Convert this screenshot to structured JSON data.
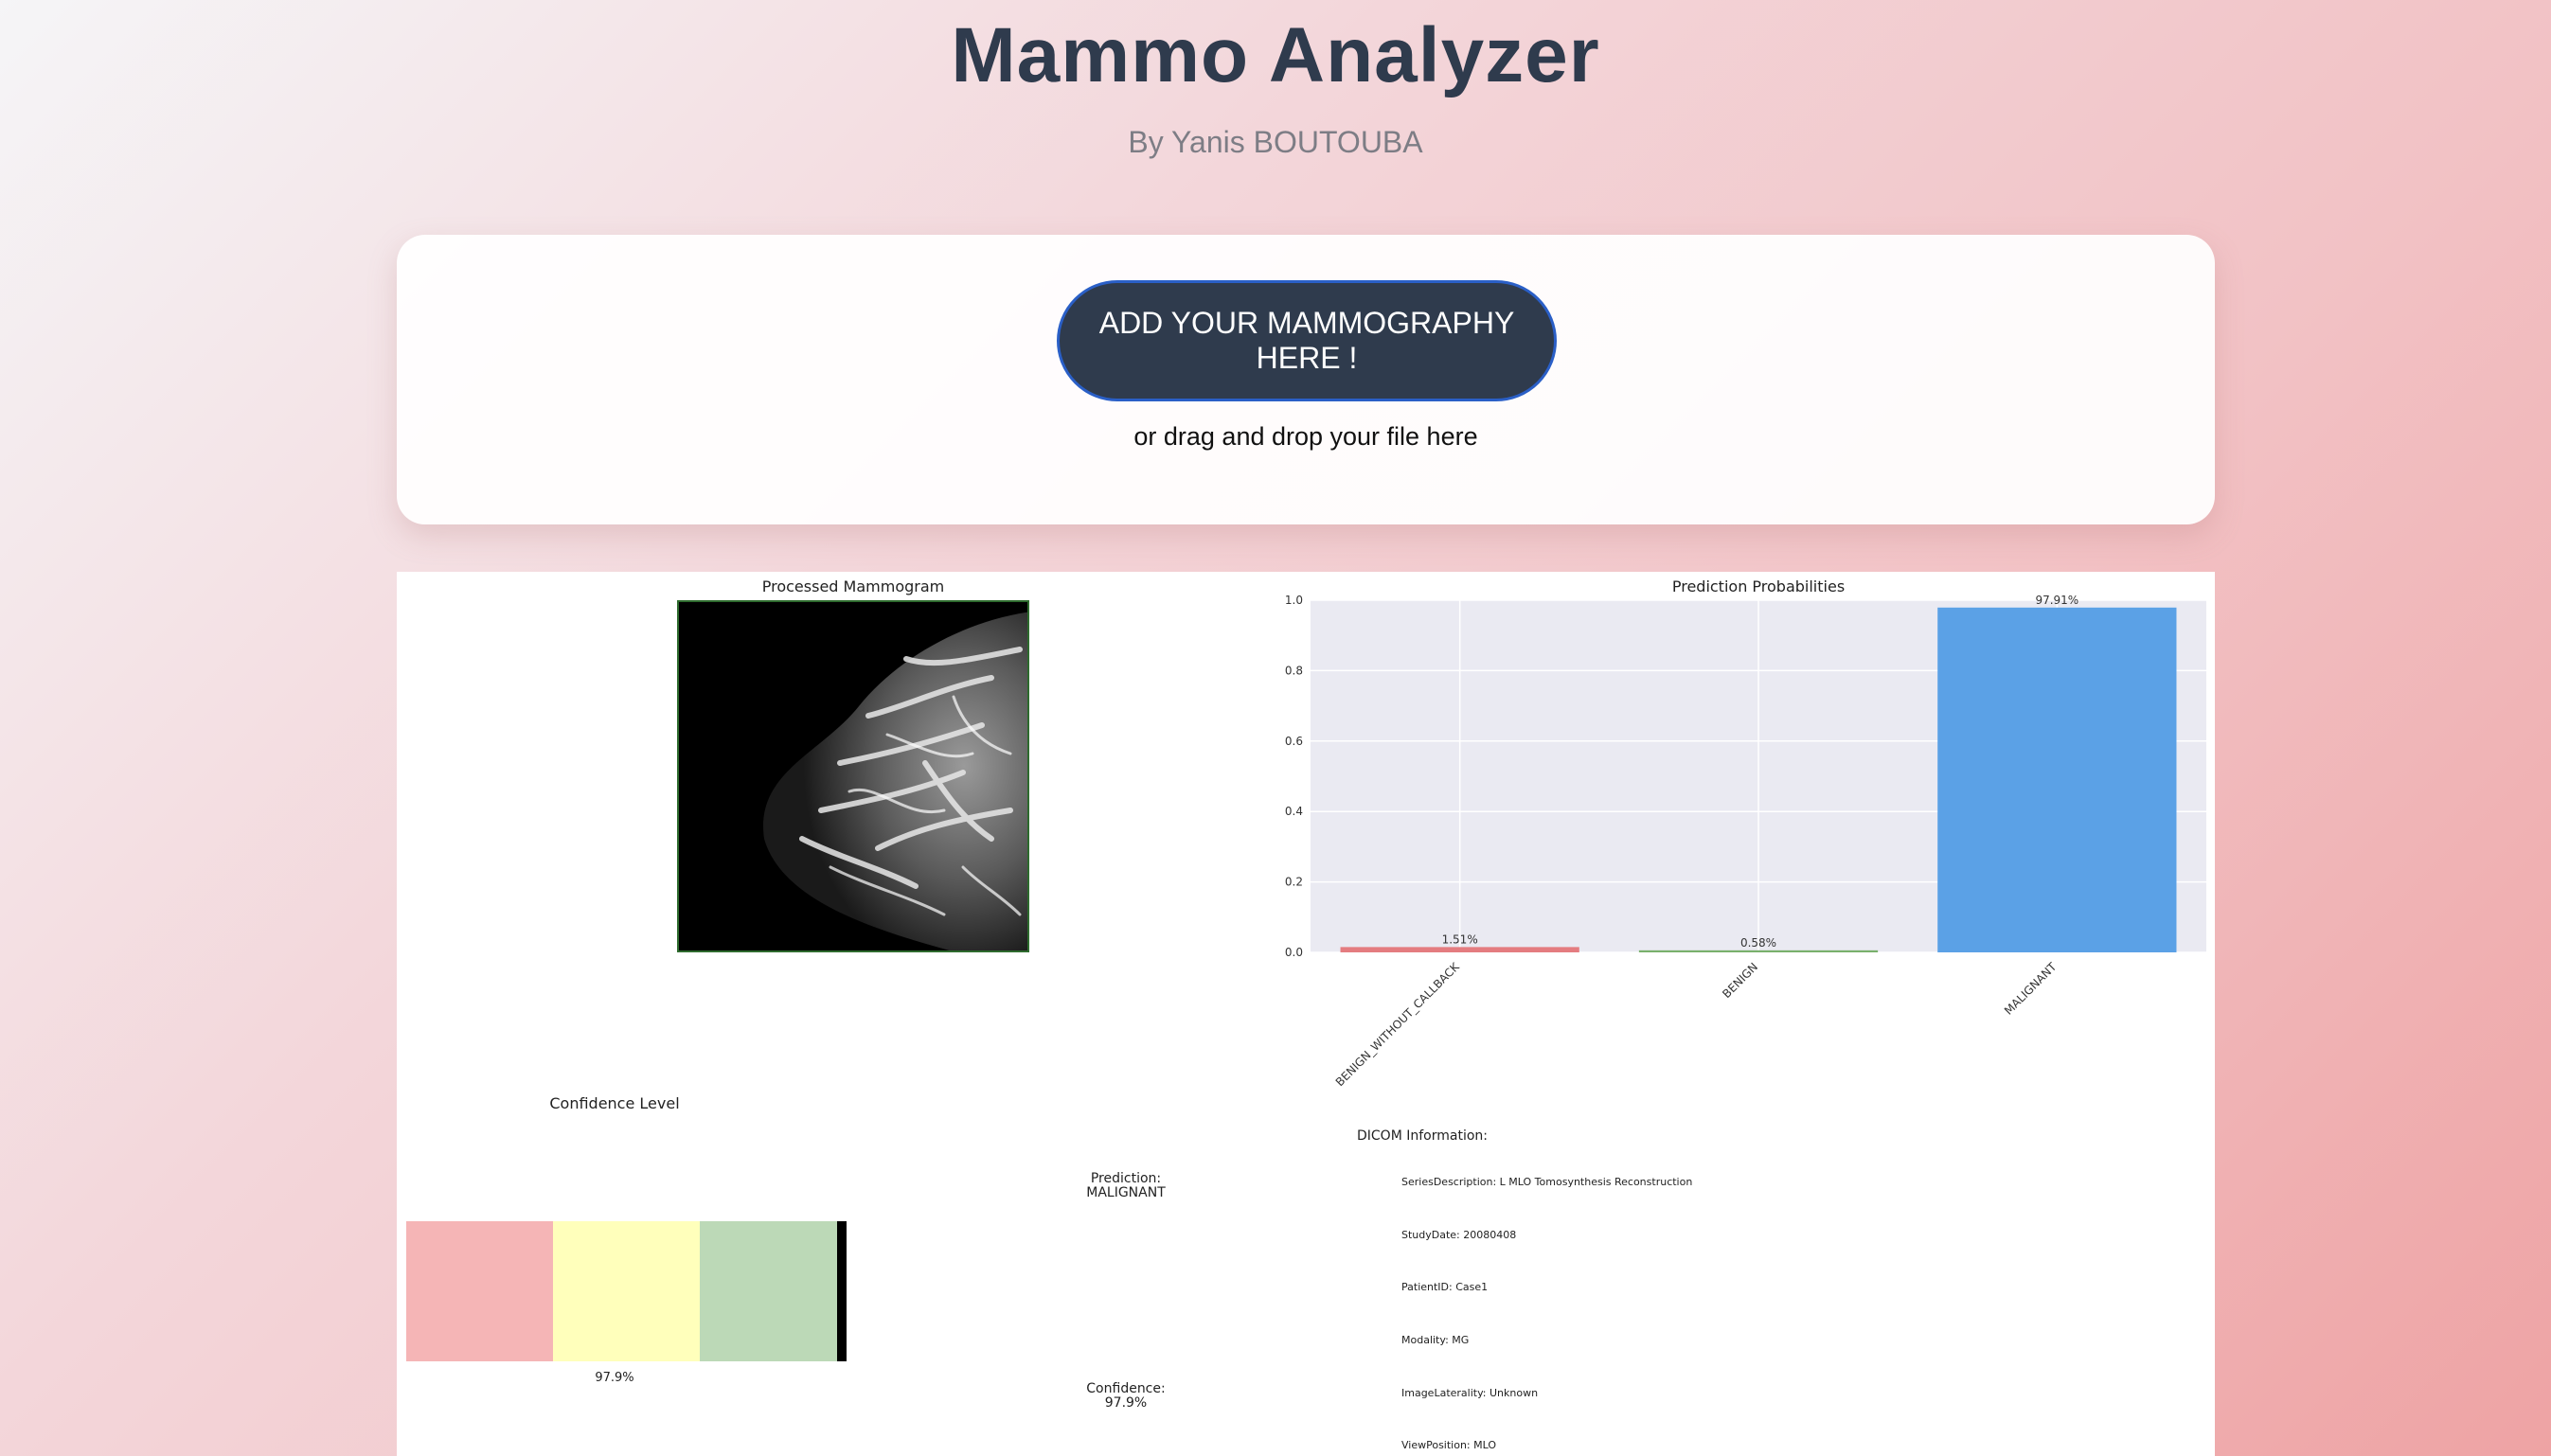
{
  "header": {
    "title": "Mammo Analyzer",
    "subtitle": "By Yanis BOUTOUBA"
  },
  "upload": {
    "button_label": "ADD YOUR MAMMOGRAPHY HERE !",
    "drop_hint": "or drag and drop your file here"
  },
  "results": {
    "image_title": "Processed Mammogram",
    "confidence_title": "Confidence Level",
    "prediction_label": "Prediction:",
    "prediction_value": "MALIGNANT",
    "confidence_label": "Confidence:",
    "confidence_value": "97.9%",
    "gauge_value_label": "97.9%",
    "gauge_level": 0.979,
    "gauge_colors": [
      "#f5b5b6",
      "#ffffbb",
      "#bcd9b7"
    ],
    "dicom_title": "DICOM Information:",
    "dicom_lines": [
      "SeriesDescription: L MLO Tomosynthesis Reconstruction",
      "StudyDate: 20080408",
      "PatientID: Case1",
      "Modality: MG",
      "ImageLaterality: Unknown",
      "ViewPosition: MLO"
    ]
  },
  "chart_data": {
    "type": "bar",
    "title": "Prediction Probabilities",
    "categories": [
      "BENIGN_WITHOUT_CALLBACK",
      "BENIGN",
      "MALIGNANT"
    ],
    "values": [
      0.0151,
      0.0058,
      0.9791
    ],
    "data_labels": [
      "1.51%",
      "0.58%",
      "97.91%"
    ],
    "colors": [
      "#e47c80",
      "#79b06c",
      "#5ba1e6"
    ],
    "ylim": [
      0,
      1.0
    ],
    "yticks": [
      "0.0",
      "0.2",
      "0.4",
      "0.6",
      "0.8",
      "1.0"
    ],
    "grid": true,
    "xlabel": "",
    "ylabel": ""
  }
}
